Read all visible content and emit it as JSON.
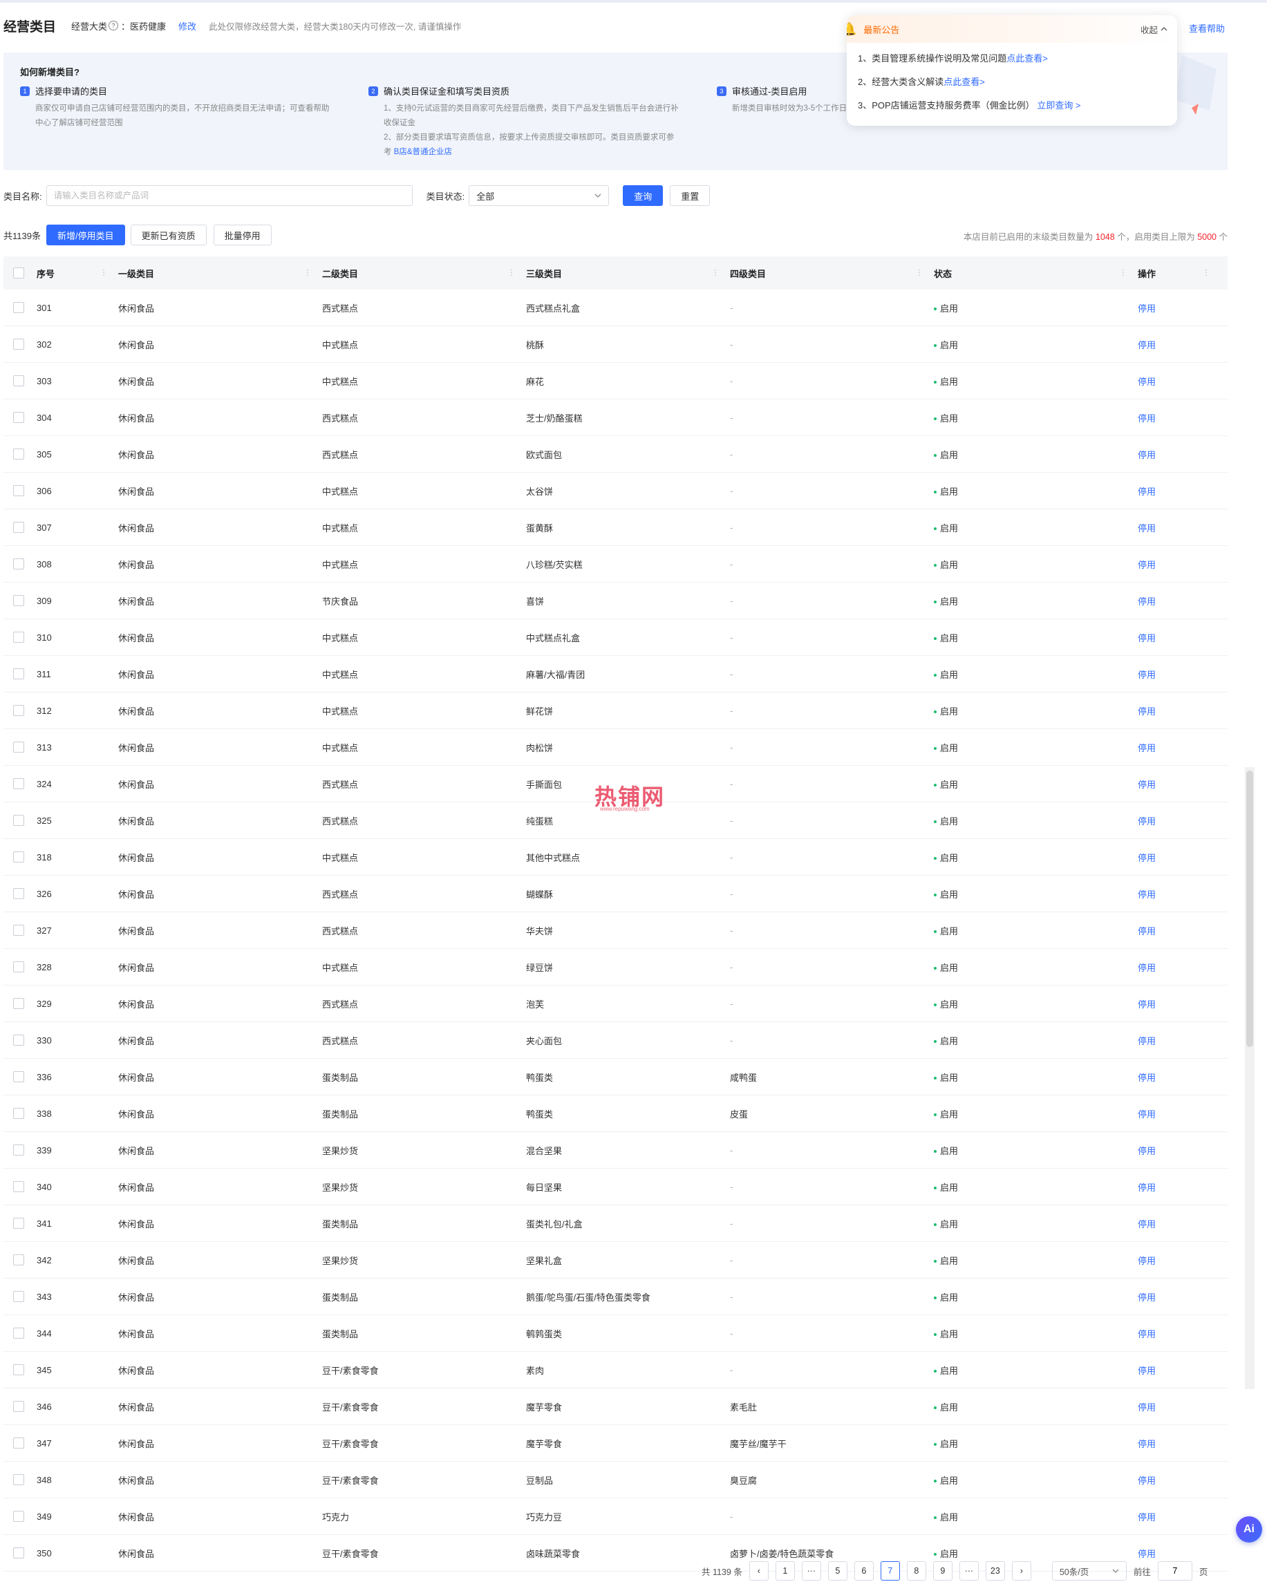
{
  "header": {
    "title": "经营类目",
    "category_label": "经营大类",
    "help_icon": "?",
    "category_value": "：医药健康",
    "edit_label": "修改",
    "note": "此处仅限修改经营大类，经营大类180天内可修改一次, 请谨慎操作",
    "help_link": "查看帮助"
  },
  "guide": {
    "title": "如何新增类目?",
    "steps": [
      {
        "num": "1",
        "title": "选择要申请的类目",
        "desc": [
          "商家仅可申请自己店铺可经营范围内的类目，不开放招商类目无法申请；可查看帮助",
          "中心了解店铺可经营范围"
        ],
        "link_prefix": "",
        "link": ""
      },
      {
        "num": "2",
        "title": "确认类目保证金和填写类目资质",
        "desc": [
          "1、支持0元试运营的类目商家可先经营后缴费，类目下产品发生销售后平台会进行补",
          "收保证金",
          "2、部分类目要求填写资质信息，按要求上传资质提交审核即可。类目资质要求可参"
        ],
        "link_prefix": "考 ",
        "link": "B店&普通企业店"
      },
      {
        "num": "3",
        "title": "审核通过-类目启用",
        "desc": [
          "新增类目审核时效为3-5个工作日"
        ],
        "link_prefix": "",
        "link": ""
      }
    ]
  },
  "notice": {
    "title": "最新公告",
    "collapse": "收起",
    "items": [
      {
        "text": "1、类目管理系统操作说明及常见问题",
        "link": "点此查看>"
      },
      {
        "text": "2、经营大类含义解读",
        "link": "点此查看>"
      },
      {
        "text": "3、POP店铺运营支持服务费率（佣金比例）",
        "link": "立即查询 >"
      }
    ]
  },
  "filter": {
    "name_label": "类目名称:",
    "name_placeholder": "请输入类目名称或产品词",
    "status_label": "类目状态:",
    "status_value": "全部",
    "query": "查询",
    "reset": "重置"
  },
  "toolbar": {
    "count": "共1139条",
    "add_btn": "新增/停用类目",
    "update_btn": "更新已有资质",
    "batch_btn": "批量停用",
    "limit_prefix": "本店目前已启用的末级类目数量为",
    "limit_count": "1048",
    "limit_mid": "个，启用类目上限为",
    "limit_max": "5000",
    "limit_suffix": "个"
  },
  "table": {
    "columns": [
      "序号",
      "一级类目",
      "二级类目",
      "三级类目",
      "四级类目",
      "状态",
      "操作"
    ],
    "status_text": "启用",
    "op_text": "停用",
    "rows": [
      {
        "seq": "301",
        "l1": "休闲食品",
        "l2": "西式糕点",
        "l3": "西式糕点礼盒",
        "l4": "-"
      },
      {
        "seq": "302",
        "l1": "休闲食品",
        "l2": "中式糕点",
        "l3": "桃酥",
        "l4": "-"
      },
      {
        "seq": "303",
        "l1": "休闲食品",
        "l2": "中式糕点",
        "l3": "麻花",
        "l4": "-"
      },
      {
        "seq": "304",
        "l1": "休闲食品",
        "l2": "西式糕点",
        "l3": "芝士/奶酪蛋糕",
        "l4": "-"
      },
      {
        "seq": "305",
        "l1": "休闲食品",
        "l2": "西式糕点",
        "l3": "欧式面包",
        "l4": "-"
      },
      {
        "seq": "306",
        "l1": "休闲食品",
        "l2": "中式糕点",
        "l3": "太谷饼",
        "l4": "-"
      },
      {
        "seq": "307",
        "l1": "休闲食品",
        "l2": "中式糕点",
        "l3": "蛋黄酥",
        "l4": "-"
      },
      {
        "seq": "308",
        "l1": "休闲食品",
        "l2": "中式糕点",
        "l3": "八珍糕/芡实糕",
        "l4": "-"
      },
      {
        "seq": "309",
        "l1": "休闲食品",
        "l2": "节庆食品",
        "l3": "喜饼",
        "l4": "-"
      },
      {
        "seq": "310",
        "l1": "休闲食品",
        "l2": "中式糕点",
        "l3": "中式糕点礼盒",
        "l4": "-"
      },
      {
        "seq": "311",
        "l1": "休闲食品",
        "l2": "中式糕点",
        "l3": "麻薯/大福/青团",
        "l4": "-"
      },
      {
        "seq": "312",
        "l1": "休闲食品",
        "l2": "中式糕点",
        "l3": "鲜花饼",
        "l4": "-"
      },
      {
        "seq": "313",
        "l1": "休闲食品",
        "l2": "中式糕点",
        "l3": "肉松饼",
        "l4": "-"
      },
      {
        "seq": "324",
        "l1": "休闲食品",
        "l2": "西式糕点",
        "l3": "手撕面包",
        "l4": "-"
      },
      {
        "seq": "325",
        "l1": "休闲食品",
        "l2": "西式糕点",
        "l3": "纯蛋糕",
        "l4": "-"
      },
      {
        "seq": "318",
        "l1": "休闲食品",
        "l2": "中式糕点",
        "l3": "其他中式糕点",
        "l4": "-"
      },
      {
        "seq": "326",
        "l1": "休闲食品",
        "l2": "西式糕点",
        "l3": "蝴蝶酥",
        "l4": "-"
      },
      {
        "seq": "327",
        "l1": "休闲食品",
        "l2": "西式糕点",
        "l3": "华夫饼",
        "l4": "-"
      },
      {
        "seq": "328",
        "l1": "休闲食品",
        "l2": "中式糕点",
        "l3": "绿豆饼",
        "l4": "-"
      },
      {
        "seq": "329",
        "l1": "休闲食品",
        "l2": "西式糕点",
        "l3": "泡芙",
        "l4": "-"
      },
      {
        "seq": "330",
        "l1": "休闲食品",
        "l2": "西式糕点",
        "l3": "夹心面包",
        "l4": "-"
      },
      {
        "seq": "336",
        "l1": "休闲食品",
        "l2": "蛋类制品",
        "l3": "鸭蛋类",
        "l4": "咸鸭蛋"
      },
      {
        "seq": "338",
        "l1": "休闲食品",
        "l2": "蛋类制品",
        "l3": "鸭蛋类",
        "l4": "皮蛋"
      },
      {
        "seq": "339",
        "l1": "休闲食品",
        "l2": "坚果炒货",
        "l3": "混合坚果",
        "l4": "-"
      },
      {
        "seq": "340",
        "l1": "休闲食品",
        "l2": "坚果炒货",
        "l3": "每日坚果",
        "l4": "-"
      },
      {
        "seq": "341",
        "l1": "休闲食品",
        "l2": "蛋类制品",
        "l3": "蛋类礼包/礼盒",
        "l4": "-"
      },
      {
        "seq": "342",
        "l1": "休闲食品",
        "l2": "坚果炒货",
        "l3": "坚果礼盒",
        "l4": "-"
      },
      {
        "seq": "343",
        "l1": "休闲食品",
        "l2": "蛋类制品",
        "l3": "鹅蛋/鸵鸟蛋/石蛋/特色蛋类零食",
        "l4": "-"
      },
      {
        "seq": "344",
        "l1": "休闲食品",
        "l2": "蛋类制品",
        "l3": "鹌鹑蛋类",
        "l4": "-"
      },
      {
        "seq": "345",
        "l1": "休闲食品",
        "l2": "豆干/素食零食",
        "l3": "素肉",
        "l4": "-"
      },
      {
        "seq": "346",
        "l1": "休闲食品",
        "l2": "豆干/素食零食",
        "l3": "魔芋零食",
        "l4": "素毛肚"
      },
      {
        "seq": "347",
        "l1": "休闲食品",
        "l2": "豆干/素食零食",
        "l3": "魔芋零食",
        "l4": "魔芋丝/魔芋干"
      },
      {
        "seq": "348",
        "l1": "休闲食品",
        "l2": "豆干/素食零食",
        "l3": "豆制品",
        "l4": "臭豆腐"
      },
      {
        "seq": "349",
        "l1": "休闲食品",
        "l2": "巧克力",
        "l3": "巧克力豆",
        "l4": "-"
      },
      {
        "seq": "350",
        "l1": "休闲食品",
        "l2": "豆干/素食零食",
        "l3": "卤味蔬菜零食",
        "l4": "卤萝卜/卤姜/特色蔬菜零食"
      }
    ]
  },
  "pager": {
    "total": "共 1139 条",
    "pages": [
      "1",
      "···",
      "5",
      "6",
      "7",
      "8",
      "9",
      "···",
      "23"
    ],
    "active": "7",
    "prev": "‹",
    "next": "›",
    "page_size": "50条/页",
    "goto_label": "前往",
    "goto_value": "7",
    "goto_suffix": "页"
  },
  "watermark": {
    "text": "热铺网",
    "sub": "www.repuwang.com"
  },
  "ai_label": "Ai",
  "colors": {
    "primary": "#2f6bff",
    "success": "#19be6b",
    "danger": "#f5222d",
    "notice": "#ff6a00"
  }
}
